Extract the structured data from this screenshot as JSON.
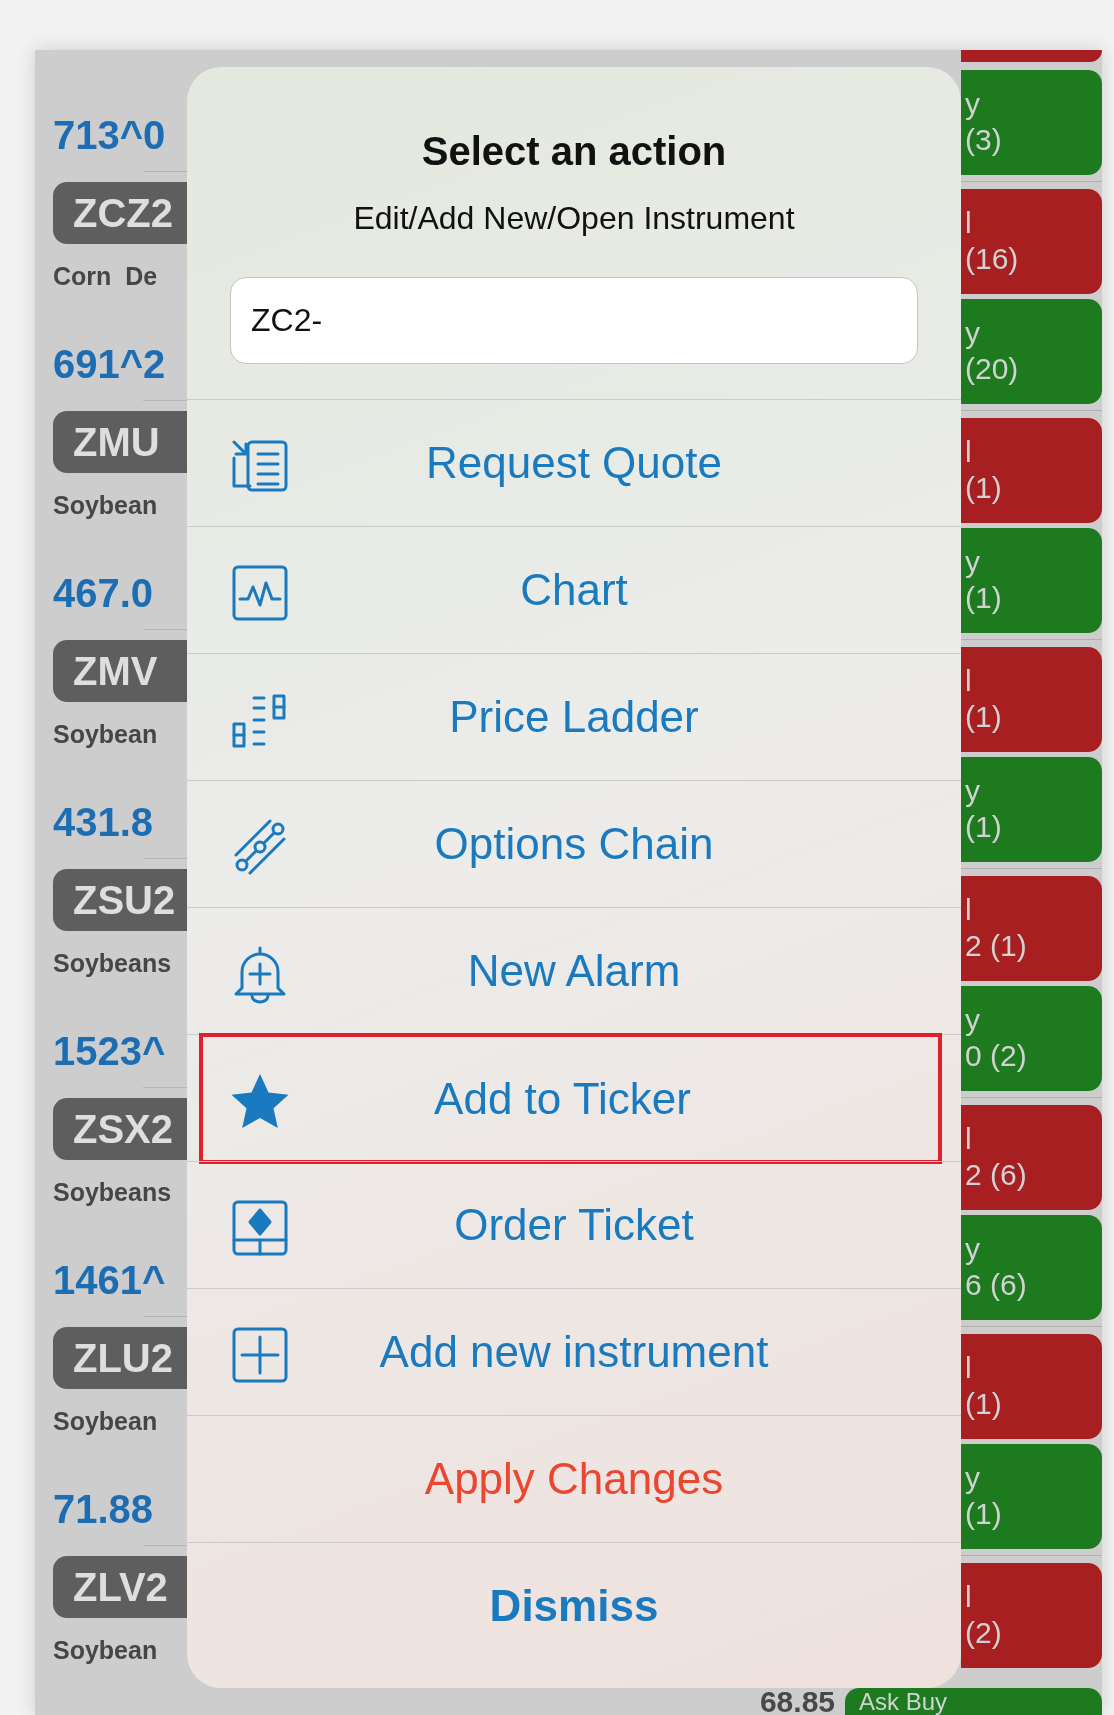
{
  "instruments": [
    {
      "price": "713^0",
      "code": "ZCZ2",
      "description": "Corn  De"
    },
    {
      "price": "691^2",
      "code": "ZMU",
      "description": "Soybean"
    },
    {
      "price": "467.0",
      "code": "ZMV",
      "description": "Soybean"
    },
    {
      "price": "431.8",
      "code": "ZSU2",
      "description": "Soybeans"
    },
    {
      "price": "1523^",
      "code": "ZSX2",
      "description": "Soybeans"
    },
    {
      "price": "1461^",
      "code": "ZLU2",
      "description": "Soybean"
    },
    {
      "price": "71.88",
      "code": "ZLV2",
      "description": "Soybean"
    }
  ],
  "order_buttons": [
    {
      "kind": "buy",
      "lines": [
        "y",
        "(3)"
      ]
    },
    {
      "kind": "sell",
      "lines": [
        "l",
        "(16)"
      ]
    },
    {
      "kind": "buy",
      "lines": [
        "y",
        "(20)"
      ]
    },
    {
      "kind": "sell",
      "lines": [
        "l",
        "(1)"
      ]
    },
    {
      "kind": "buy",
      "lines": [
        "y",
        "(1)"
      ]
    },
    {
      "kind": "sell",
      "lines": [
        "l",
        "(1)"
      ]
    },
    {
      "kind": "buy",
      "lines": [
        "y",
        "(1)"
      ]
    },
    {
      "kind": "sell",
      "lines": [
        "l",
        "2 (1)"
      ]
    },
    {
      "kind": "buy",
      "lines": [
        "y",
        "0 (2)"
      ]
    },
    {
      "kind": "sell",
      "lines": [
        "l",
        "2 (6)"
      ]
    },
    {
      "kind": "buy",
      "lines": [
        "y",
        "6 (6)"
      ]
    },
    {
      "kind": "sell",
      "lines": [
        "l",
        "(1)"
      ]
    },
    {
      "kind": "buy",
      "lines": [
        "y",
        "(1)"
      ]
    },
    {
      "kind": "sell",
      "lines": [
        "l",
        "(2)"
      ]
    }
  ],
  "bottom_row": {
    "price": "68.85",
    "button": "Ask Buy"
  },
  "dialog": {
    "title": "Select an action",
    "subtitle": "Edit/Add New/Open Instrument",
    "input": {
      "value": "ZC2-"
    },
    "actions": [
      {
        "label": "Request Quote",
        "kind": "action",
        "selected": false
      },
      {
        "label": "Chart",
        "kind": "action",
        "selected": false
      },
      {
        "label": "Price Ladder",
        "kind": "action",
        "selected": false
      },
      {
        "label": "Options Chain",
        "kind": "action",
        "selected": false
      },
      {
        "label": "New Alarm",
        "kind": "action",
        "selected": false
      },
      {
        "label": "Add to Ticker",
        "kind": "action",
        "selected": true
      },
      {
        "label": "Order Ticket",
        "kind": "action",
        "selected": false
      },
      {
        "label": "Add new instrument",
        "kind": "action",
        "selected": false
      },
      {
        "label": "Apply Changes",
        "kind": "destructive",
        "selected": false
      },
      {
        "label": "Dismiss",
        "kind": "cancel",
        "selected": false
      }
    ]
  }
}
